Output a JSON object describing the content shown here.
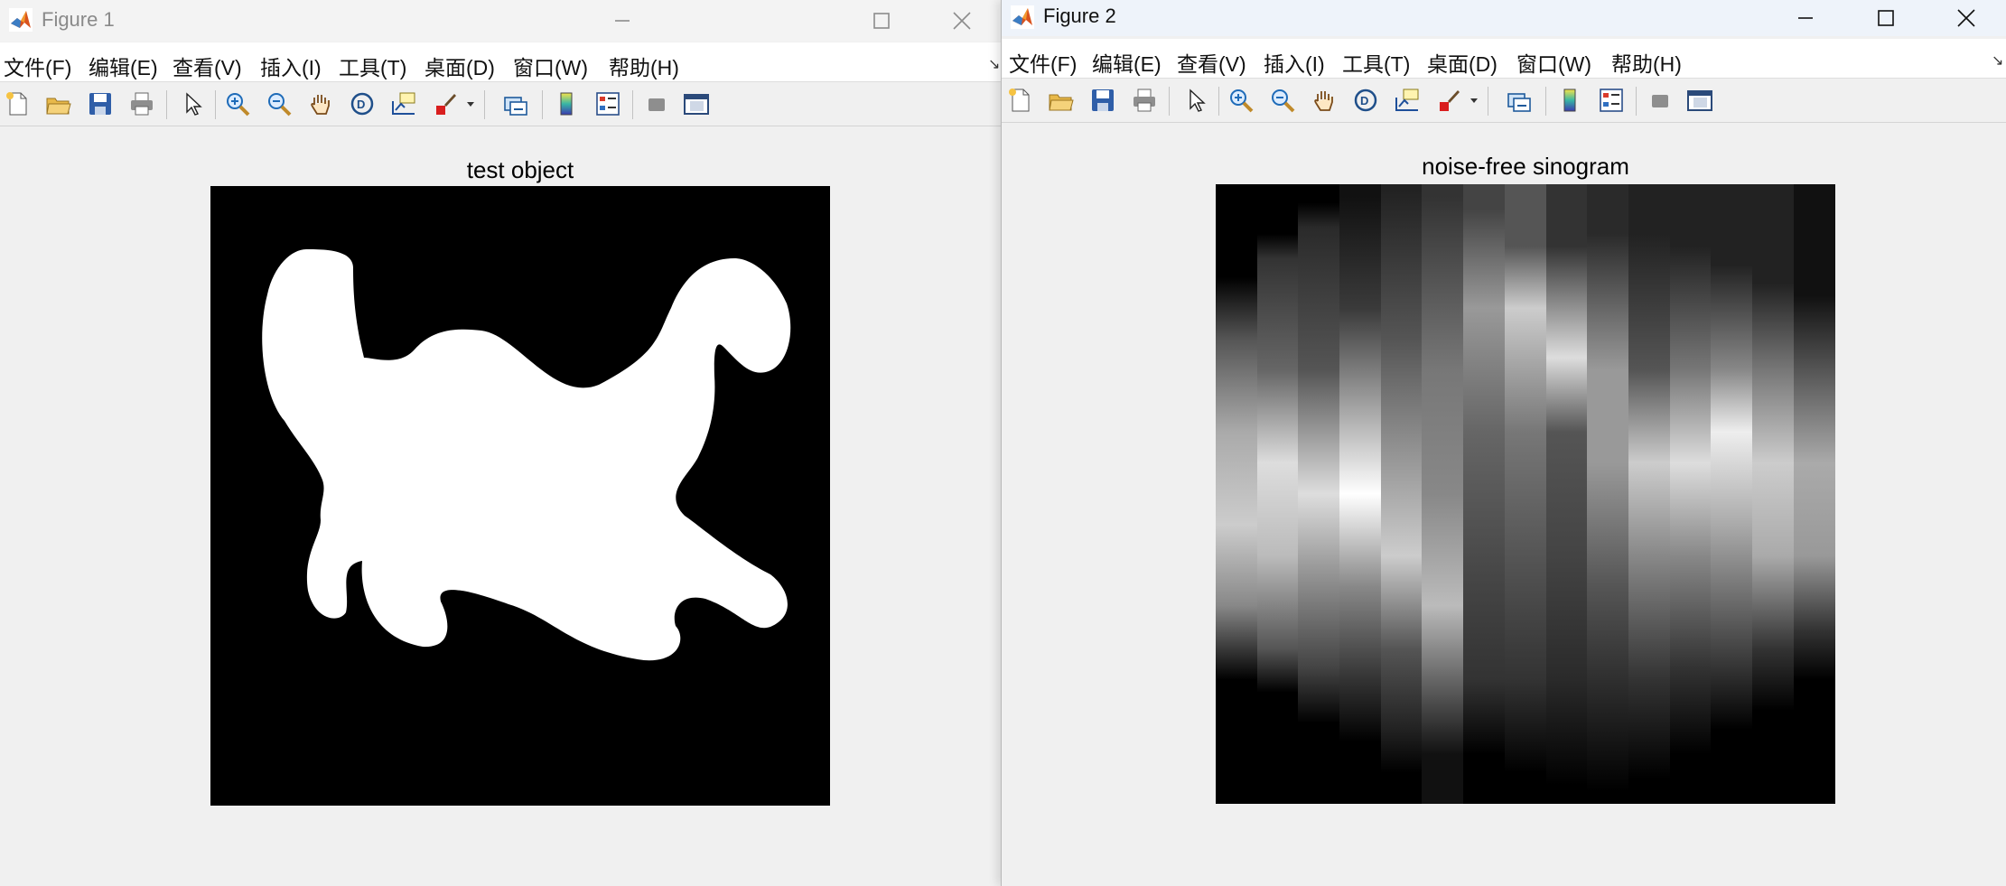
{
  "window1": {
    "title": "Figure 1",
    "menus": [
      "文件(F)",
      "编辑(E)",
      "查看(V)",
      "插入(I)",
      "工具(T)",
      "桌面(D)",
      "窗口(W)",
      "帮助(H)"
    ],
    "axes_title": "test object",
    "colormap": "gray"
  },
  "window2": {
    "title": "Figure 2",
    "menus": [
      "文件(F)",
      "编辑(E)",
      "查看(V)",
      "插入(I)",
      "工具(T)",
      "桌面(D)",
      "窗口(W)",
      "帮助(H)"
    ],
    "axes_title": "noise-free sinogram",
    "colormap": "gray"
  },
  "toolbar_icons": [
    "new-figure-icon",
    "open-file-icon",
    "save-icon",
    "print-icon",
    "select-pointer-icon",
    "zoom-in-icon",
    "zoom-out-icon",
    "pan-hand-icon",
    "rotate-3d-icon",
    "data-tips-icon",
    "brush-icon",
    "link-plot-icon",
    "insert-colorbar-icon",
    "insert-legend-icon",
    "hide-plot-tools-icon",
    "show-plot-tools-icon"
  ],
  "colors": {
    "window_bg": "#f0f0f0",
    "menubar_bg": "#ffffff",
    "image_bg": "#000000"
  }
}
